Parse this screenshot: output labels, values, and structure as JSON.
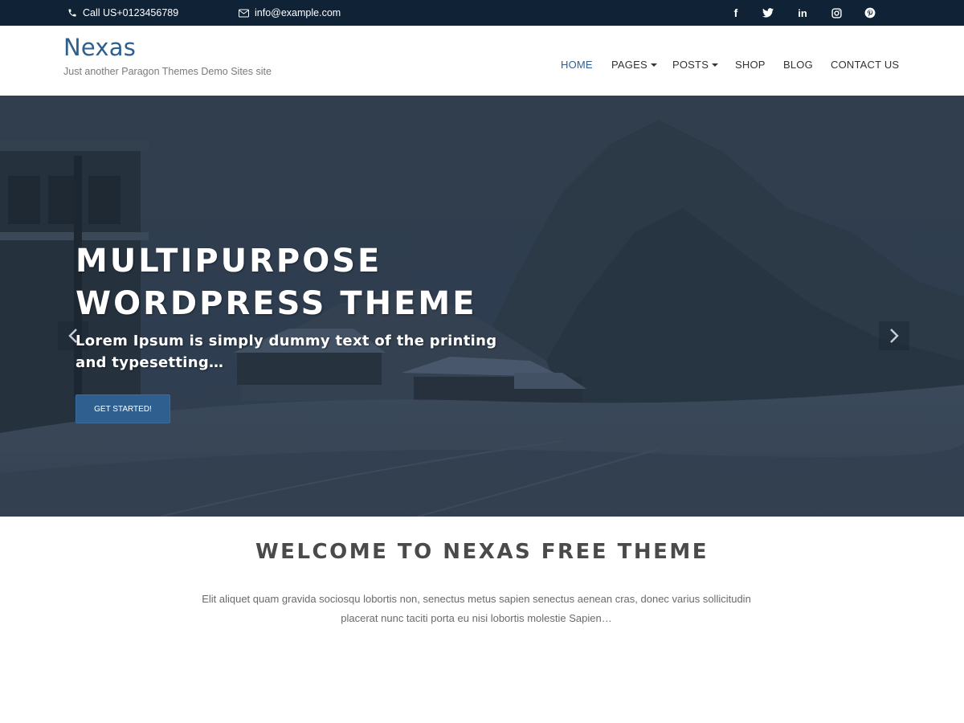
{
  "topbar": {
    "phone": "Call US+0123456789",
    "email": "info@example.com",
    "social": [
      {
        "icon": "facebook-icon",
        "glyph": "f"
      },
      {
        "icon": "twitter-icon",
        "glyph": "🐦"
      },
      {
        "icon": "linkedin-icon",
        "glyph": "in"
      },
      {
        "icon": "instagram-icon",
        "glyph": "◘"
      },
      {
        "icon": "pinterest-icon",
        "glyph": "℗"
      }
    ]
  },
  "header": {
    "site_title": "Nexas",
    "tagline": "Just another Paragon Themes Demo Sites site"
  },
  "nav": {
    "items": [
      {
        "label": "HOME",
        "active": true,
        "dropdown": false
      },
      {
        "label": "PAGES",
        "active": false,
        "dropdown": true
      },
      {
        "label": "POSTS",
        "active": false,
        "dropdown": true
      },
      {
        "label": "SHOP",
        "active": false,
        "dropdown": false
      },
      {
        "label": "BLOG",
        "active": false,
        "dropdown": false
      },
      {
        "label": "CONTACT US",
        "active": false,
        "dropdown": false
      }
    ]
  },
  "hero": {
    "title_line1": "MULTIPURPOSE",
    "title_line2": "WORDPRESS THEME",
    "subtitle": "Lorem Ipsum is simply dummy text of the printing and typesetting…",
    "cta_label": "GET STARTED!",
    "prev_icon": "chevron-left-icon",
    "next_icon": "chevron-right-icon"
  },
  "welcome": {
    "title": "WELCOME TO NEXAS FREE THEME",
    "text": "Elit aliquet quam gravida sociosqu lobortis non, senectus metus sapien senectus aenean cras, donec varius sollicitudin placerat nunc taciti porta eu nisi lobortis molestie Sapien…"
  },
  "colors": {
    "topbar_bg": "#0f2236",
    "accent": "#2e5f8f",
    "hero_overlay": "#1f2d3d"
  }
}
